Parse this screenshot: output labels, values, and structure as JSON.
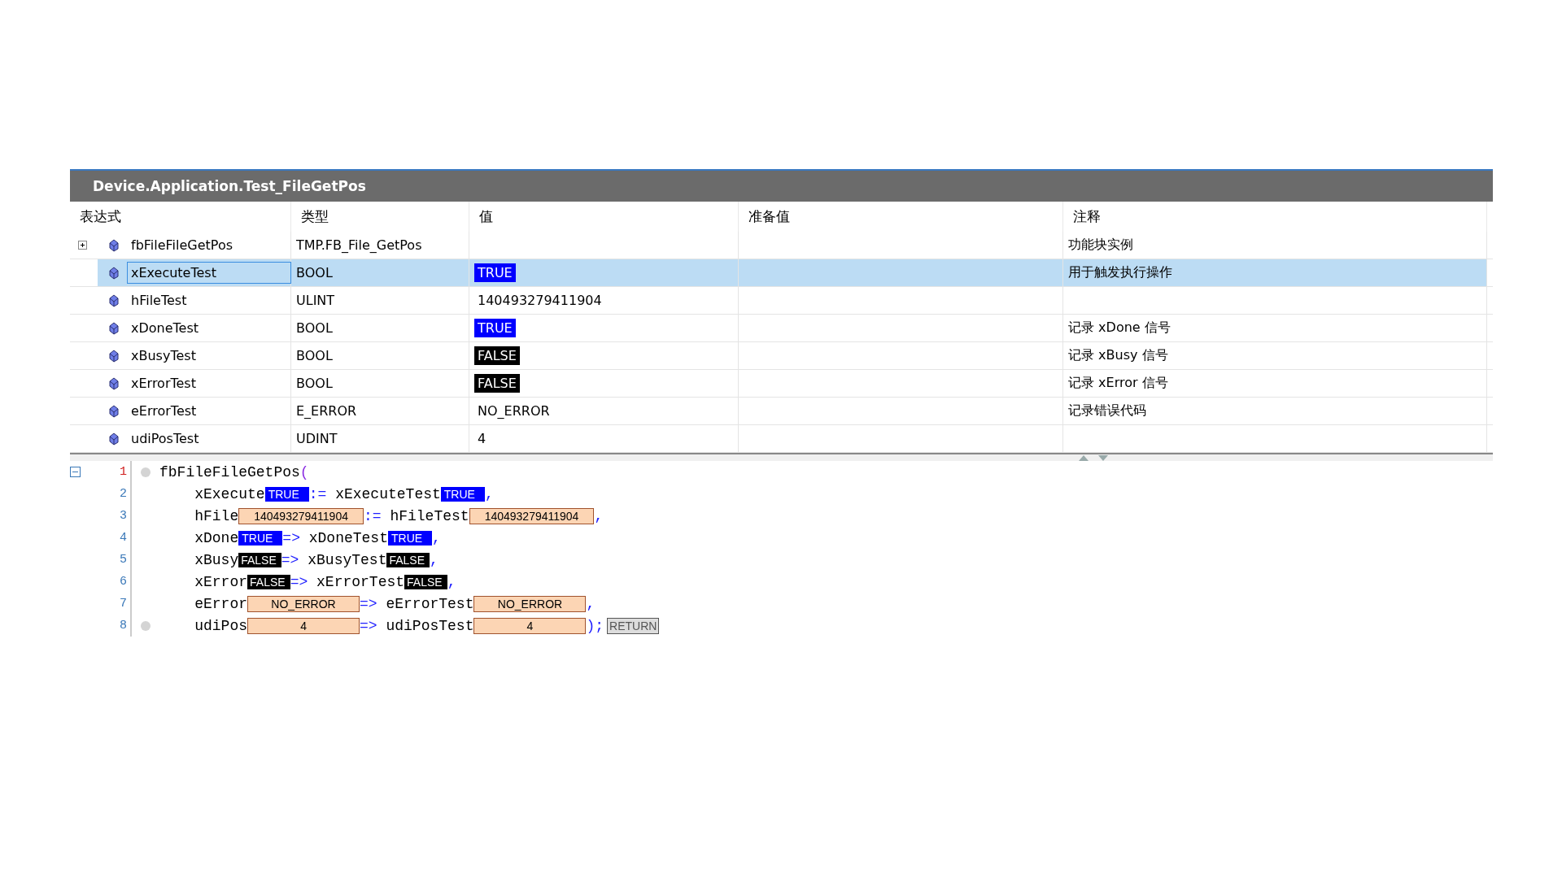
{
  "title": "Device.Application.Test_FileGetPos",
  "columns": [
    "表达式",
    "类型",
    "值",
    "准备值",
    "注释"
  ],
  "rows": [
    {
      "expression": "fbFileFileGetPos",
      "type": "TMP.FB_File_GetPos",
      "comment": "功能块实例",
      "selected": false,
      "expanded": false
    },
    {
      "expression": "xExecuteTest",
      "type": "BOOL",
      "value": "TRUE",
      "kind": "true",
      "comment": "用于触发执行操作",
      "selected": true
    },
    {
      "expression": "hFileTest",
      "type": "ULINT",
      "value": "140493279411904",
      "kind": "text",
      "selected": false
    },
    {
      "expression": "xDoneTest",
      "type": "BOOL",
      "value": "TRUE",
      "kind": "true",
      "comment": "记录 xDone 信号",
      "selected": false
    },
    {
      "expression": "xBusyTest",
      "type": "BOOL",
      "value": "FALSE",
      "kind": "false",
      "comment": "记录 xBusy 信号",
      "selected": false
    },
    {
      "expression": "xErrorTest",
      "type": "BOOL",
      "value": "FALSE",
      "kind": "false",
      "comment": "记录 xError 信号",
      "selected": false
    },
    {
      "expression": "eErrorTest",
      "type": "E_ERROR",
      "value": "NO_ERROR",
      "kind": "text",
      "comment": "记录错误代码",
      "selected": false
    },
    {
      "expression": "udiPosTest",
      "type": "UDINT",
      "value": "4",
      "kind": "text",
      "selected": false
    }
  ],
  "code": [
    {
      "number": "1",
      "current": true,
      "breakpoint": true,
      "fold": true,
      "tokens": [
        {
          "kind": "code",
          "text": "fbFileFileGetPos"
        },
        {
          "kind": "paren",
          "text": "("
        }
      ]
    },
    {
      "number": "2",
      "current": false,
      "breakpoint": false,
      "tokens": [
        {
          "kind": "code",
          "text": "    xExecute"
        },
        {
          "kind": "true",
          "text": "TRUE"
        },
        {
          "kind": "op",
          "text": ":="
        },
        {
          "kind": "code",
          "text": " xExecuteTest"
        },
        {
          "kind": "true",
          "text": "TRUE"
        },
        {
          "kind": "op",
          "text": ","
        }
      ]
    },
    {
      "number": "3",
      "current": false,
      "breakpoint": false,
      "tokens": [
        {
          "kind": "code",
          "text": "    hFile"
        },
        {
          "kind": "value",
          "text": "140493279411904"
        },
        {
          "kind": "op",
          "text": ":="
        },
        {
          "kind": "code",
          "text": " hFileTest"
        },
        {
          "kind": "value",
          "text": "140493279411904"
        },
        {
          "kind": "op",
          "text": ","
        }
      ]
    },
    {
      "number": "4",
      "current": false,
      "breakpoint": false,
      "tokens": [
        {
          "kind": "code",
          "text": "    xDone"
        },
        {
          "kind": "true",
          "text": "TRUE"
        },
        {
          "kind": "op",
          "text": "=>"
        },
        {
          "kind": "code",
          "text": " xDoneTest"
        },
        {
          "kind": "true",
          "text": "TRUE"
        },
        {
          "kind": "op",
          "text": ","
        }
      ]
    },
    {
      "number": "5",
      "current": false,
      "breakpoint": false,
      "tokens": [
        {
          "kind": "code",
          "text": "    xBusy"
        },
        {
          "kind": "false",
          "text": "FALSE"
        },
        {
          "kind": "op",
          "text": "=>"
        },
        {
          "kind": "code",
          "text": " xBusyTest"
        },
        {
          "kind": "false",
          "text": "FALSE"
        },
        {
          "kind": "op",
          "text": ","
        }
      ]
    },
    {
      "number": "6",
      "current": false,
      "breakpoint": false,
      "tokens": [
        {
          "kind": "code",
          "text": "    xError"
        },
        {
          "kind": "false",
          "text": "FALSE"
        },
        {
          "kind": "op",
          "text": "=>"
        },
        {
          "kind": "code",
          "text": " xErrorTest"
        },
        {
          "kind": "false",
          "text": "FALSE"
        },
        {
          "kind": "op",
          "text": ","
        }
      ]
    },
    {
      "number": "7",
      "current": false,
      "breakpoint": false,
      "tokens": [
        {
          "kind": "code",
          "text": "    eError"
        },
        {
          "kind": "value",
          "text": "NO_ERROR"
        },
        {
          "kind": "op",
          "text": "=>"
        },
        {
          "kind": "code",
          "text": " eErrorTest"
        },
        {
          "kind": "value",
          "text": "NO_ERROR"
        },
        {
          "kind": "op",
          "text": ","
        }
      ]
    },
    {
      "number": "8",
      "current": false,
      "breakpoint": true,
      "tokens": [
        {
          "kind": "code",
          "text": "    udiPos"
        },
        {
          "kind": "value",
          "text": "4"
        },
        {
          "kind": "op",
          "text": "=>"
        },
        {
          "kind": "code",
          "text": " udiPosTest"
        },
        {
          "kind": "value",
          "text": "4"
        },
        {
          "kind": "op",
          "text": ");"
        },
        {
          "kind": "return",
          "text": "RETURN"
        }
      ]
    }
  ]
}
